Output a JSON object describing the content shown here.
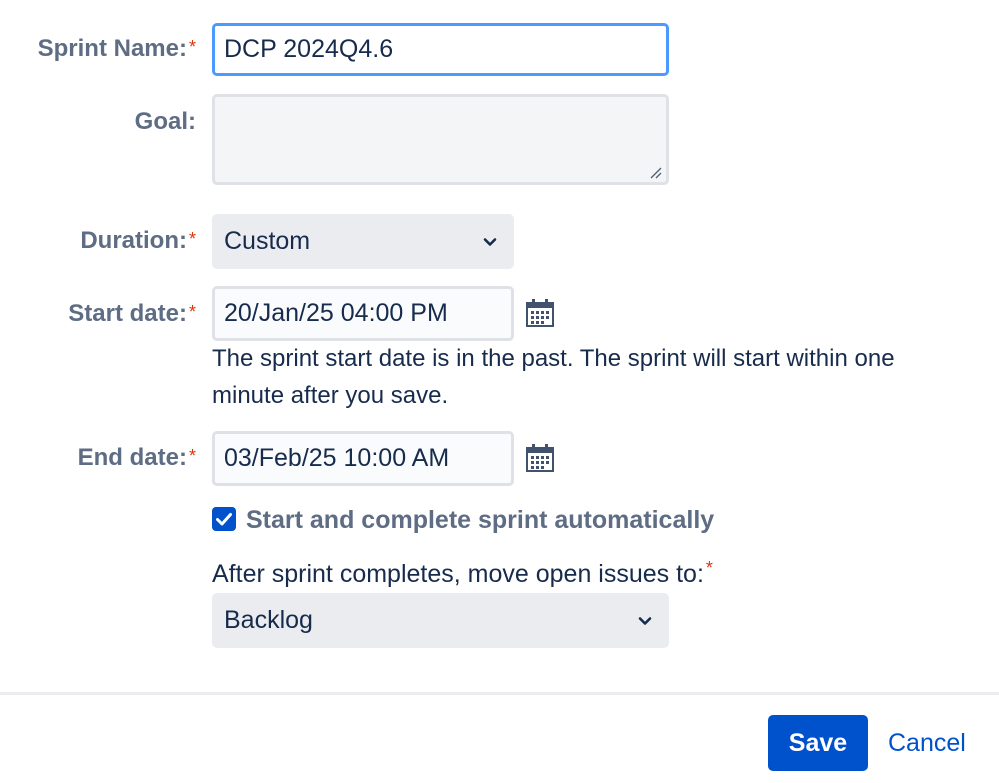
{
  "form": {
    "sprint_name": {
      "label": "Sprint Name:",
      "required_mark": "*",
      "value": "DCP 2024Q4.6"
    },
    "goal": {
      "label": "Goal:",
      "value": ""
    },
    "duration": {
      "label": "Duration:",
      "required_mark": "*",
      "selected": "Custom"
    },
    "start_date": {
      "label": "Start date:",
      "required_mark": "*",
      "value": "20/Jan/25 04:00 PM",
      "help_text": "The sprint start date is in the past. The sprint will start within one minute after you save."
    },
    "end_date": {
      "label": "End date:",
      "required_mark": "*",
      "value": "03/Feb/25 10:00 AM"
    },
    "auto_sprint": {
      "label": "Start and complete sprint automatically",
      "checked": true
    },
    "move_issues": {
      "label": "After sprint completes, move open issues to:",
      "required_mark": "*",
      "selected": "Backlog"
    }
  },
  "footer": {
    "save_label": "Save",
    "cancel_label": "Cancel"
  },
  "colors": {
    "primary": "#0052cc",
    "required": "#de350b",
    "focus_border": "#4c9aff",
    "label_text": "#5e6c84"
  }
}
